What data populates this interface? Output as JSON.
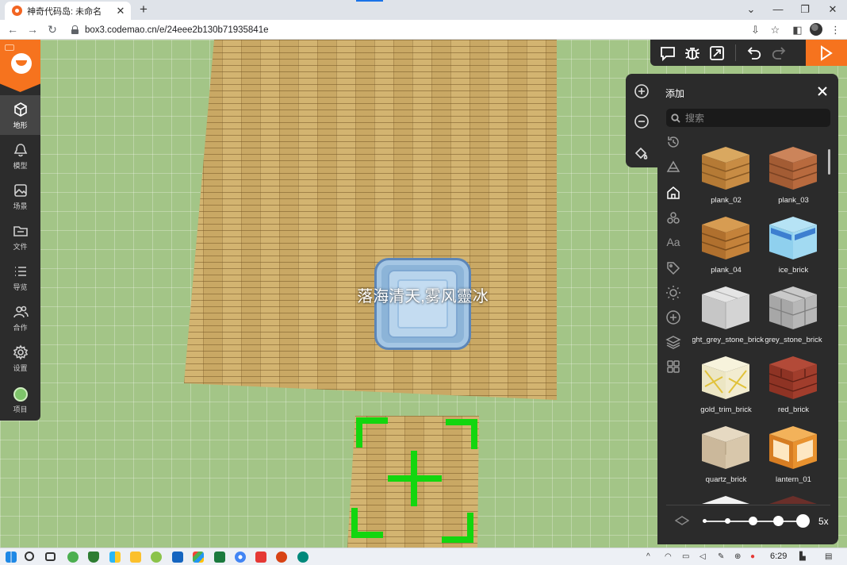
{
  "browser": {
    "tab_title": "神奇代码岛: 未命名",
    "url": "box3.codemao.cn/e/24eee2b130b71935841e"
  },
  "nav": {
    "items": [
      {
        "label": "地形",
        "icon": "cube-icon"
      },
      {
        "label": "模型",
        "icon": "bell-icon"
      },
      {
        "label": "场景",
        "icon": "image-icon"
      },
      {
        "label": "文件",
        "icon": "folder-icon"
      },
      {
        "label": "导览",
        "icon": "list-icon"
      },
      {
        "label": "合作",
        "icon": "people-icon"
      },
      {
        "label": "设置",
        "icon": "gear-icon"
      },
      {
        "label": "项目",
        "icon": "project-icon"
      }
    ],
    "active_index": 0
  },
  "scene": {
    "block_label": "落海清天,雾风靈冰"
  },
  "panel": {
    "title": "添加",
    "search_placeholder": "搜索",
    "category_text_label": "Aa",
    "items": [
      {
        "name": "plank_02"
      },
      {
        "name": "plank_03"
      },
      {
        "name": "plank_04"
      },
      {
        "name": "ice_brick"
      },
      {
        "name": "light_grey_stone_brick"
      },
      {
        "name": "grey_stone_brick"
      },
      {
        "name": "gold_trim_brick"
      },
      {
        "name": "red_brick"
      },
      {
        "name": "quartz_brick"
      },
      {
        "name": "lantern_01"
      }
    ],
    "brush_size": "5x"
  },
  "taskbar": {
    "time": "6:29"
  },
  "colors": {
    "accent": "#f6731e",
    "panel_bg": "#2b2b2b",
    "selector_green": "#13d60f"
  }
}
